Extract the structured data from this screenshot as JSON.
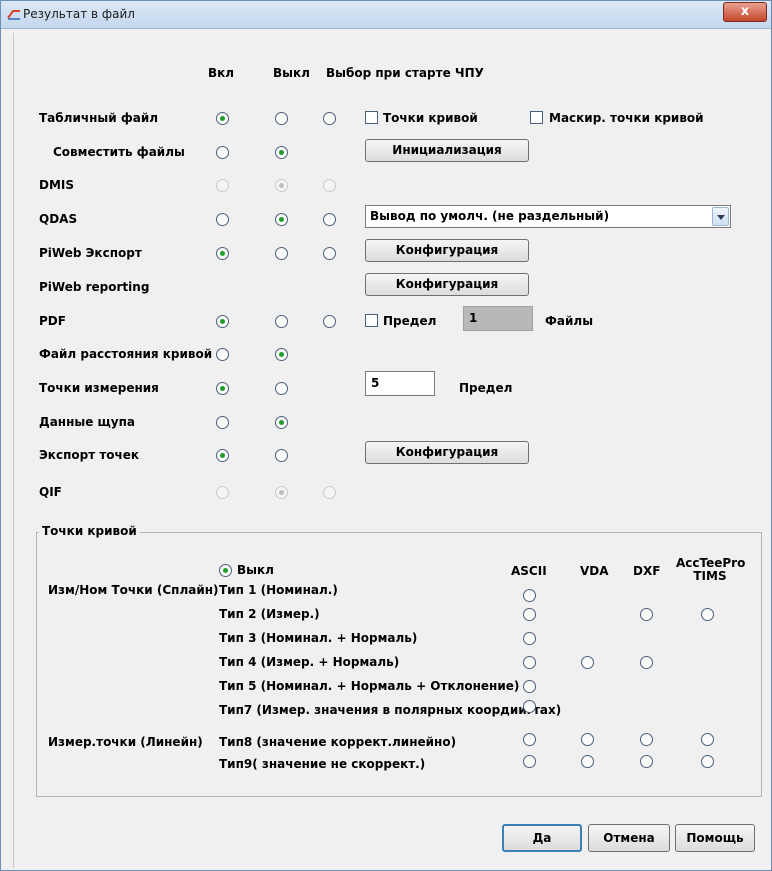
{
  "window": {
    "title": "Результат в файл",
    "close_label": "x"
  },
  "columns": {
    "on": "Вкл",
    "off": "Выкл",
    "choice": "Выбор при старте ЧПУ"
  },
  "rows": {
    "table_file": {
      "label": "Табличный файл",
      "check_curve_points": "Точки кривой",
      "check_mask_curve_points": "Маскир. точки кривой"
    },
    "merge_files": {
      "label": "Совместить файлы",
      "button": "Инициализация"
    },
    "dmis": {
      "label": "DMIS"
    },
    "qdas": {
      "label": "QDAS",
      "select_value": "Вывод по умолч. (не раздельный)"
    },
    "piweb_export": {
      "label": "PiWeb Экспорт",
      "button": "Конфигурация"
    },
    "piweb_reporting": {
      "label": "PiWeb reporting",
      "button": "Конфигурация"
    },
    "pdf": {
      "label": "PDF",
      "check_limit": "Предел",
      "limit_value": "1",
      "files_label": "Файлы"
    },
    "curve_distance_file": {
      "label": "Файл расстояния кривой"
    },
    "measure_points": {
      "label": "Точки измерения",
      "value": "5",
      "limit_label": "Предел"
    },
    "probe_data": {
      "label": "Данные щупа"
    },
    "export_points": {
      "label": "Экспорт точек",
      "button": "Конфигурация"
    },
    "qif": {
      "label": "QIF"
    }
  },
  "curve_group": {
    "title": "Точки кривой",
    "off_label": "Выкл",
    "col_ascii": "ASCII",
    "col_vda": "VDA",
    "col_dxf": "DXF",
    "col_acc": "AccTeePro\nTIMS",
    "spline_label": "Изм/Ном Точки (Сплайн)",
    "linear_label": "Измер.точки (Линейн)",
    "types": [
      "Тип 1 (Номинал.)",
      "Тип 2 (Измер.)",
      "Тип 3 (Номинал. + Нормаль)",
      "Тип 4 (Измер. + Нормаль)",
      "Тип 5 (Номинал. + Нормаль + Отклонение)",
      "Тип7 (Измер. значения в полярных коордиигтах)",
      "Тип8 (значение коррект.линейно)",
      "Тип9( значение не скоррект.)"
    ]
  },
  "buttons": {
    "ok": "Да",
    "cancel": "Отмена",
    "help": "Помощь"
  }
}
